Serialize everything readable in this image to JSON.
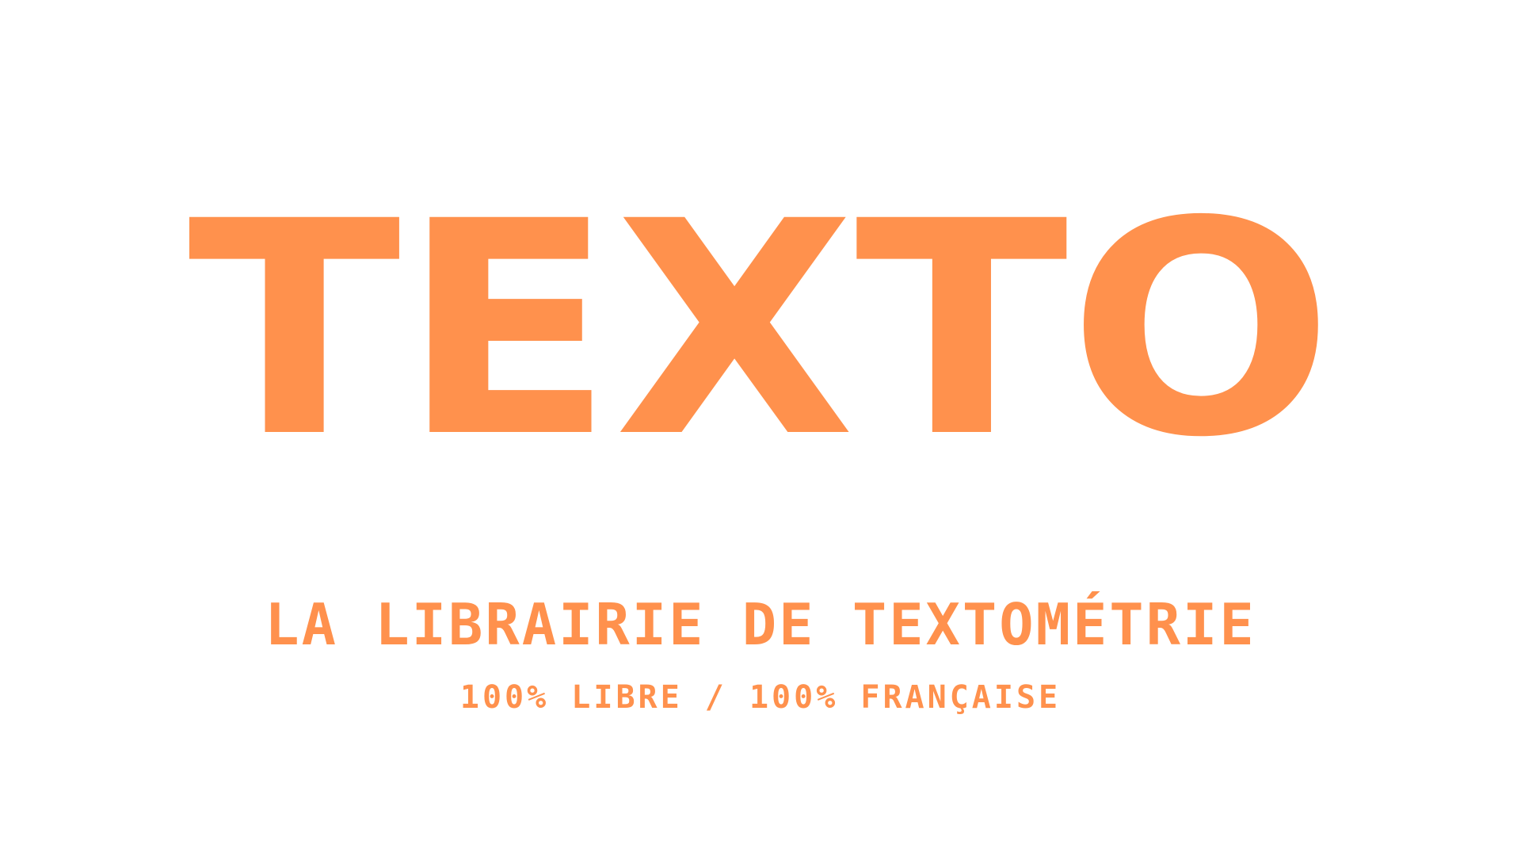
{
  "brand": {
    "wordmark": "TEXTO",
    "tagline": "LA LIBRAIRIE DE TEXTOMÉTRIE",
    "subtitle": "100% LIBRE / 100% FRANÇAISE"
  },
  "colors": {
    "background": "#FFFFFF",
    "accent": "#FF914D"
  }
}
